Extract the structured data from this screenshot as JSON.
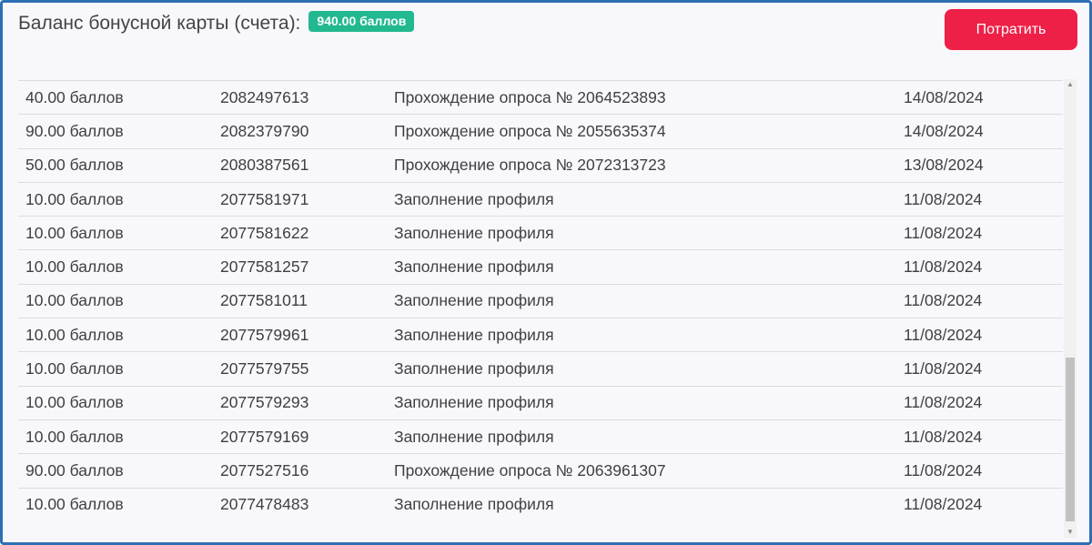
{
  "header": {
    "title": "Баланс бонусной карты (счета):",
    "balance_badge": "940.00 баллов",
    "spend_button_label": "Потратить"
  },
  "colors": {
    "badge": "#22b890",
    "button": "#ee2047",
    "frame_border": "#2e6fb4"
  },
  "transactions": [
    {
      "amount": "40.00 баллов",
      "id": "2082497613",
      "description": "Прохождение опроса № 2064523893",
      "date": "14/08/2024"
    },
    {
      "amount": "90.00 баллов",
      "id": "2082379790",
      "description": "Прохождение опроса № 2055635374",
      "date": "14/08/2024"
    },
    {
      "amount": "50.00 баллов",
      "id": "2080387561",
      "description": "Прохождение опроса № 2072313723",
      "date": "13/08/2024"
    },
    {
      "amount": "10.00 баллов",
      "id": "2077581971",
      "description": "Заполнение профиля",
      "date": "11/08/2024"
    },
    {
      "amount": "10.00 баллов",
      "id": "2077581622",
      "description": "Заполнение профиля",
      "date": "11/08/2024"
    },
    {
      "amount": "10.00 баллов",
      "id": "2077581257",
      "description": "Заполнение профиля",
      "date": "11/08/2024"
    },
    {
      "amount": "10.00 баллов",
      "id": "2077581011",
      "description": "Заполнение профиля",
      "date": "11/08/2024"
    },
    {
      "amount": "10.00 баллов",
      "id": "2077579961",
      "description": "Заполнение профиля",
      "date": "11/08/2024"
    },
    {
      "amount": "10.00 баллов",
      "id": "2077579755",
      "description": "Заполнение профиля",
      "date": "11/08/2024"
    },
    {
      "amount": "10.00 баллов",
      "id": "2077579293",
      "description": "Заполнение профиля",
      "date": "11/08/2024"
    },
    {
      "amount": "10.00 баллов",
      "id": "2077579169",
      "description": "Заполнение профиля",
      "date": "11/08/2024"
    },
    {
      "amount": "90.00 баллов",
      "id": "2077527516",
      "description": "Прохождение опроса № 2063961307",
      "date": "11/08/2024"
    },
    {
      "amount": "10.00 баллов",
      "id": "2077478483",
      "description": "Заполнение профиля",
      "date": "11/08/2024"
    }
  ],
  "icons": {
    "scroll_up": "scroll-up-arrow-icon",
    "scroll_down": "scroll-down-arrow-icon"
  }
}
